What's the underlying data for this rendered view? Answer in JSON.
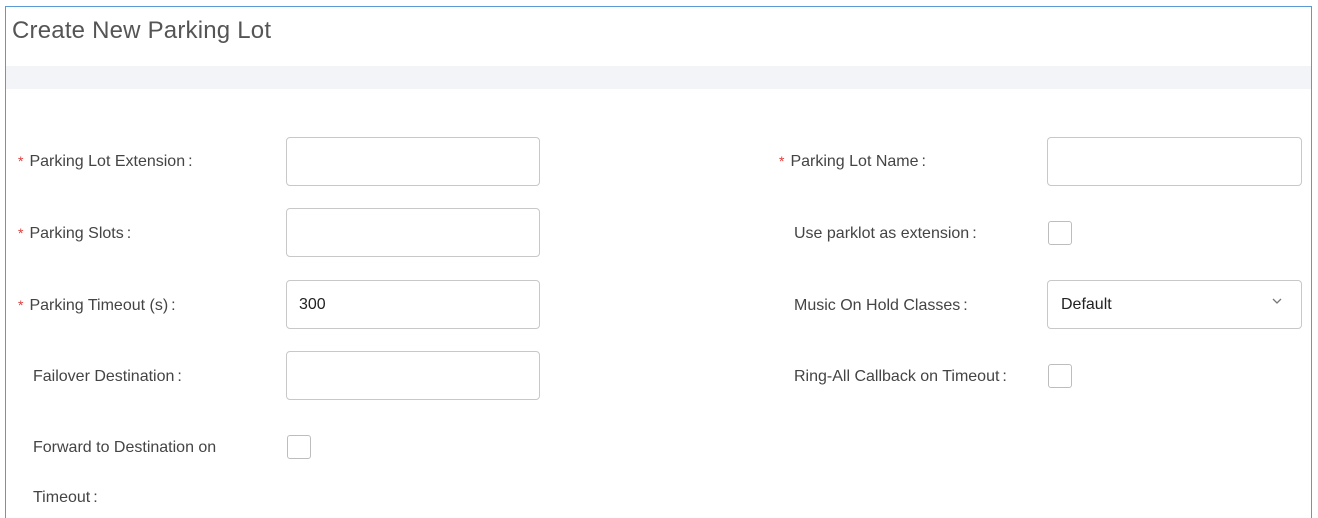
{
  "dialog": {
    "title": "Create New Parking Lot"
  },
  "form": {
    "required_mark": "*",
    "colon": ":",
    "parking_lot_extension": {
      "label": "Parking Lot Extension",
      "value": ""
    },
    "parking_lot_name": {
      "label": "Parking Lot Name",
      "value": ""
    },
    "parking_slots": {
      "label": "Parking Slots",
      "value": ""
    },
    "use_parklot_as_extension": {
      "label": "Use parklot as extension",
      "checked": false
    },
    "parking_timeout": {
      "label": "Parking Timeout (s)",
      "value": "300"
    },
    "music_on_hold_classes": {
      "label": "Music On Hold Classes",
      "selected": "Default"
    },
    "failover_destination": {
      "label": "Failover Destination",
      "value": ""
    },
    "ring_all_callback": {
      "label": "Ring-All Callback on Timeout",
      "checked": false
    },
    "forward_to_destination": {
      "label_line1": "Forward to Destination on",
      "label_line2": "Timeout",
      "checked": false
    }
  },
  "icons": {
    "select_arrow": "chevron-down-icon"
  },
  "colors": {
    "required": "#e03a3a",
    "frame_border": "#5b9bd5",
    "band": "#f2f4f8"
  }
}
